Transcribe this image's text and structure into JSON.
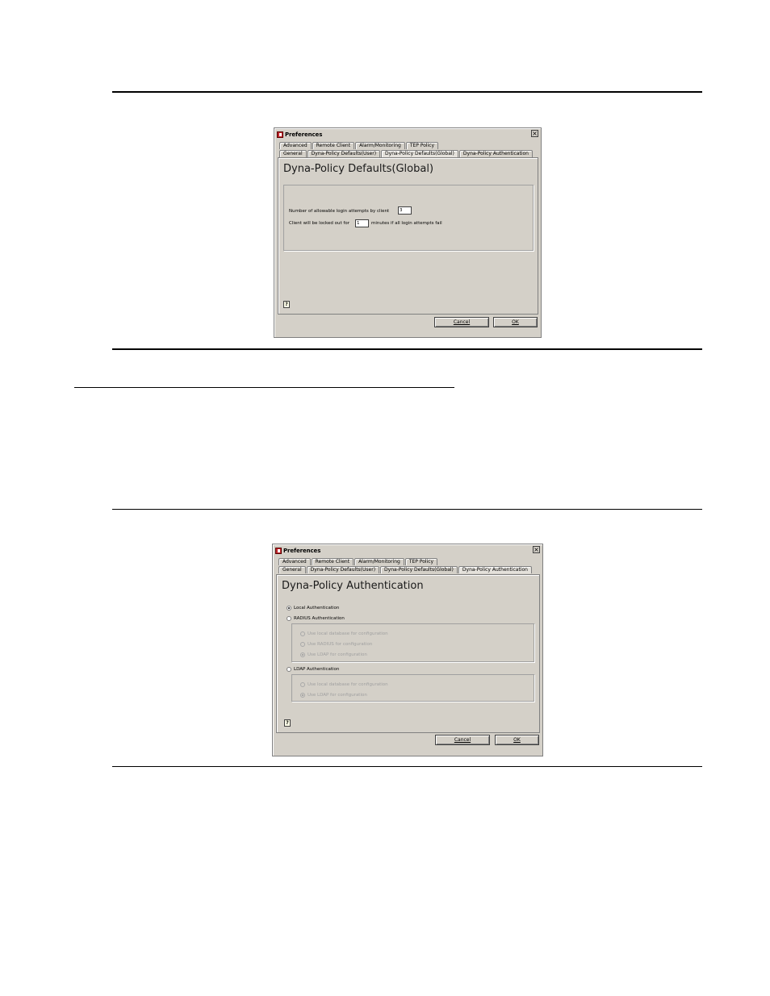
{
  "dialog1": {
    "title": "Preferences",
    "tabs_row1": [
      "Advanced",
      "Remote Client",
      "Alarm/Monitoring",
      "TEP Policy"
    ],
    "tabs_row2": [
      "General",
      "Dyna-Policy Defaults(User)",
      "Dyna-Policy Defaults(Global)",
      "Dyna-Policy Authentication"
    ],
    "active_tab": "Dyna-Policy Defaults(Global)",
    "panel_title": "Dyna-Policy Defaults(Global)",
    "login_attempts_label": "Number of allowable login attempts by client",
    "login_attempts_value": "3",
    "lockout_prefix": "Client will be locked out for",
    "lockout_value": "1",
    "lockout_suffix": "minutes if all login attempts fail",
    "cancel_label": "Cancel",
    "ok_label": "OK"
  },
  "dialog2": {
    "title": "Preferences",
    "tabs_row1": [
      "Advanced",
      "Remote Client",
      "Alarm/Monitoring",
      "TEP Policy"
    ],
    "tabs_row2": [
      "General",
      "Dyna-Policy Defaults(User)",
      "Dyna-Policy Defaults(Global)",
      "Dyna-Policy Authentication"
    ],
    "active_tab": "Dyna-Policy Authentication",
    "panel_title": "Dyna-Policy Authentication",
    "local_auth_label": "Local Authentication",
    "radius_auth_label": "RADIUS Authentication",
    "radius_options": [
      "Use local database for configuration",
      "Use RADIUS for configuration",
      "Use LDAP for configuration"
    ],
    "ldap_auth_label": "LDAP Authentication",
    "ldap_options": [
      "Use local database for configuration",
      "Use LDAP for configuration"
    ],
    "cancel_label": "Cancel",
    "ok_label": "OK"
  },
  "icons": [
    "app-icon",
    "close-icon",
    "help-icon"
  ],
  "colors": {
    "dialog_bg": "#d4d0c8",
    "app_icon": "#c0272d"
  }
}
